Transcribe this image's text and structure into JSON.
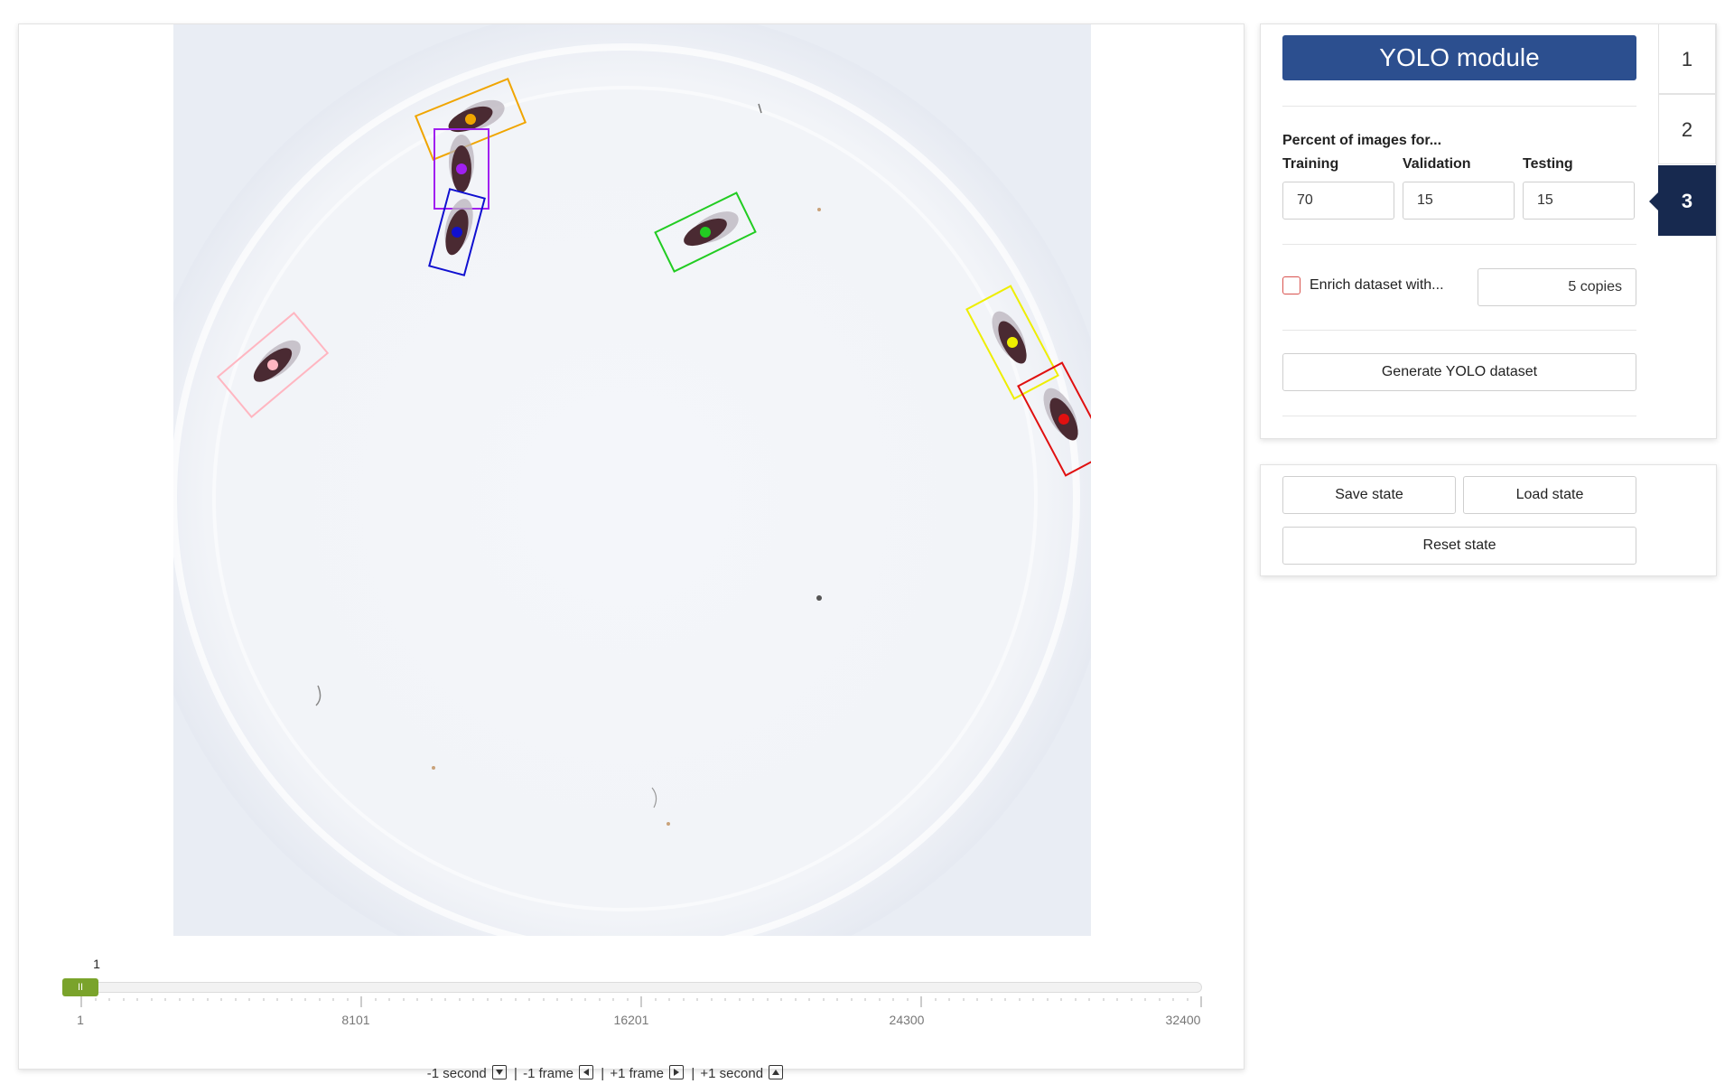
{
  "viewer": {
    "frame_number": "1",
    "slider": {
      "min": 1,
      "max": 32400,
      "value": 1,
      "handle_glyph": "II"
    },
    "tick_labels": [
      "1",
      "8101",
      "16201",
      "24300",
      "32400"
    ],
    "nav": {
      "minus_second": "-1 second",
      "minus_frame": "-1 frame",
      "plus_frame": "+1 frame",
      "plus_second": "+1 second",
      "separator": "|"
    },
    "detections": [
      {
        "color": "#f0a500"
      },
      {
        "color": "#a020f0"
      },
      {
        "color": "#1010d0"
      },
      {
        "color": "#22cc22"
      },
      {
        "color": "#ffb6c1"
      },
      {
        "color": "#eeee00"
      },
      {
        "color": "#e01010"
      }
    ]
  },
  "yolo": {
    "title": "YOLO module",
    "percent_heading": "Percent of images for...",
    "training_label": "Training",
    "validation_label": "Validation",
    "testing_label": "Testing",
    "training_value": "70",
    "validation_value": "15",
    "testing_value": "15",
    "enrich_label": "Enrich dataset with...",
    "enrich_checked": false,
    "copies_value": "5 copies",
    "generate_label": "Generate YOLO dataset"
  },
  "tabs": [
    {
      "label": "1",
      "active": false
    },
    {
      "label": "2",
      "active": false
    },
    {
      "label": "3",
      "active": true
    }
  ],
  "state": {
    "save_label": "Save state",
    "load_label": "Load state",
    "reset_label": "Reset state"
  },
  "colors": {
    "accent": "#2c4f8f",
    "active_tab": "#17294f",
    "slider_handle": "#7aa32b"
  }
}
